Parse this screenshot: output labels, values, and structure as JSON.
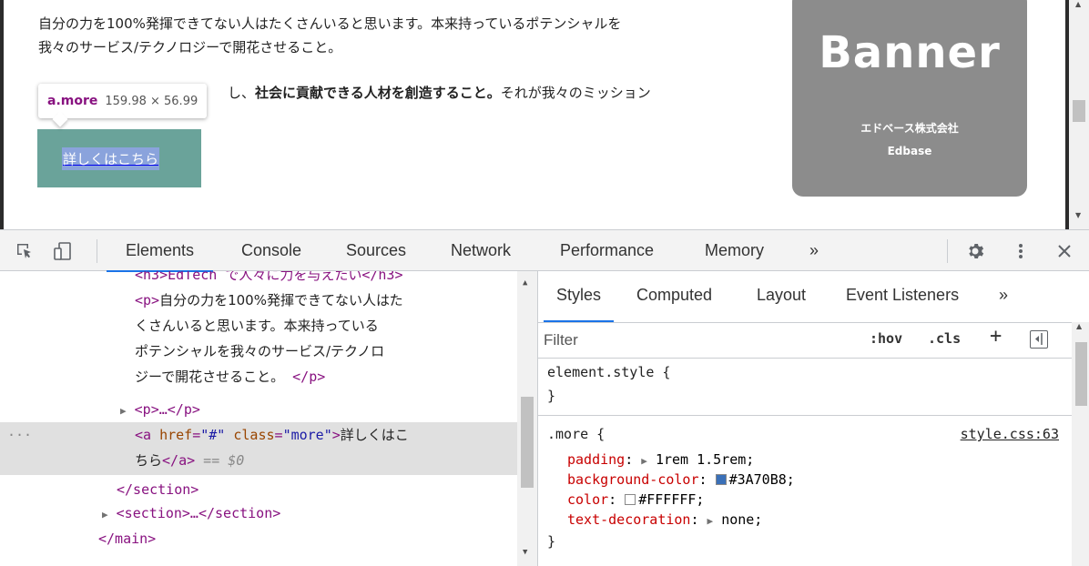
{
  "page": {
    "paragraph1_line1": "自分の力を100%発揮できてない人はたくさんいると思います。本来持っているポテンシャルを",
    "paragraph1_line2": "我々のサービス/テクノロジーで開花させること。",
    "paragraph2_pre": "し、",
    "paragraph2_bold": "社会に貢献できる人材を創造すること。",
    "paragraph2_post": "それが我々のミッション",
    "more_link_text": "詳しくはこちら",
    "tooltip_tag": "a.more",
    "tooltip_size": "159.98 × 56.99",
    "banner": {
      "title": "Banner",
      "company": "エドベース株式会社",
      "sub": "Edbase"
    }
  },
  "devtools": {
    "tabs": [
      "Elements",
      "Console",
      "Sources",
      "Network",
      "Performance",
      "Memory"
    ],
    "more_tabs": "»",
    "active_tab": "Elements",
    "elements_tree": {
      "line_h3": "<h3>EdTech で人々に力を与えたい</h3>",
      "p_open": "<p>",
      "p_text_1": "自分の力を100%発揮できてない人はた",
      "p_text_2": "くさんいると思います。本来持っている",
      "p_text_3": "ポテンシャルを我々のサービス/テクノロ",
      "p_text_4": "ジーで開花させること。",
      "p_close": "</p>",
      "collapsed_p": "<p>…</p>",
      "a_open_tag": "<a ",
      "a_href_attr": "href",
      "a_href_val": "\"#\"",
      "a_class_attr": "class",
      "a_class_val": "\"more\"",
      "a_text_1": "詳しくはこ",
      "a_text_2": "ちら",
      "a_close": "</a>",
      "selected_marker": "== $0",
      "row_dots": "···",
      "section_close": "</section>",
      "section_collapsed": "<section>…</section>",
      "main_close": "</main>"
    },
    "styles_panel": {
      "tabs": [
        "Styles",
        "Computed",
        "Layout",
        "Event Listeners"
      ],
      "more_tabs": "»",
      "active_tab": "Styles",
      "filter_placeholder": "Filter",
      "hov": ":hov",
      "cls": ".cls",
      "plus": "+",
      "element_style_selector": "element.style {",
      "close_brace": "}",
      "rule_selector": ".more {",
      "rule_source": "style.css:63",
      "declarations": [
        {
          "prop": "padding",
          "value": "1rem 1.5rem;",
          "expandable": true
        },
        {
          "prop": "background-color",
          "value": "#3A70B8;",
          "swatch": "#3A70B8"
        },
        {
          "prop": "color",
          "value": "#FFFFFF;",
          "swatch": "#FFFFFF"
        },
        {
          "prop": "text-decoration",
          "value": "none;",
          "expandable": true
        }
      ]
    }
  },
  "colors": {
    "accent": "#1a73e8",
    "tag": "#881280",
    "attr": "#994500",
    "prop": "#c80000"
  }
}
